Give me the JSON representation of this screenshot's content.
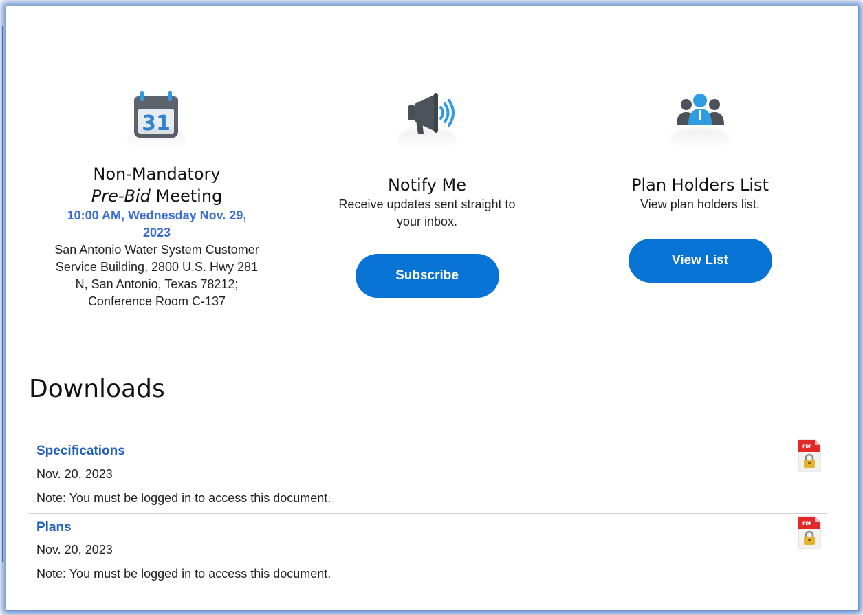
{
  "meeting": {
    "title_line1": "Non-Mandatory",
    "title_em": "Pre-Bid",
    "title_rest": " Meeting",
    "day_number": "31",
    "datetime_line1": "10:00 AM, Wednesday Nov. 29,",
    "datetime_line2": "2023",
    "location_lines": [
      "San Antonio Water System Customer",
      "Service Building, 2800 U.S. Hwy 281",
      "N, San Antonio, Texas 78212;",
      "Conference Room C-137"
    ],
    "icon": "calendar-icon"
  },
  "notify": {
    "title": "Notify Me",
    "desc_line1": "Receive updates sent straight to",
    "desc_line2": "your inbox.",
    "button_label": "Subscribe",
    "icon": "megaphone-icon"
  },
  "planholders": {
    "title": "Plan Holders List",
    "desc": "View plan holders list.",
    "button_label": "View List",
    "icon": "people-icon"
  },
  "downloads": {
    "title": "Downloads",
    "items": [
      {
        "name": "Specifications",
        "date": "Nov. 20, 2023",
        "note": "Note: You must be logged in to access this document.",
        "icon": "pdf-lock-icon"
      },
      {
        "name": "Plans",
        "date": "Nov. 20, 2023",
        "note": "Note: You must be logged in to access this document.",
        "icon": "pdf-lock-icon"
      }
    ]
  },
  "colors": {
    "button_blue": "#0773d5",
    "link_blue": "#1f5fc3",
    "date_blue": "#3a6fd0",
    "frame_glow": "#4f7bc4"
  }
}
